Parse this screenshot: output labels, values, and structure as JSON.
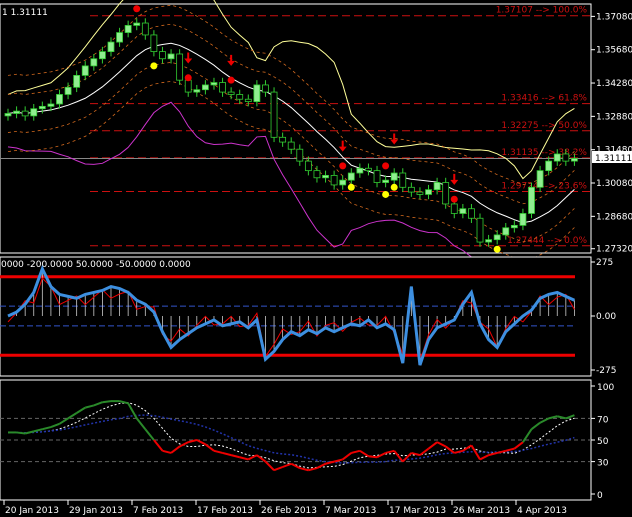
{
  "chart_data": [
    {
      "type": "candlestick",
      "title": "1 1.31111",
      "current_price": 1.31111,
      "current_price_label": "1.31111",
      "ylim": [
        1.2714,
        1.376
      ],
      "yticks": [
        "1.37080",
        "1.35680",
        "1.34280",
        "1.32880",
        "1.31480",
        "1.30080",
        "1.28680",
        "1.27320"
      ],
      "closes": [
        1.33,
        1.331,
        1.329,
        1.332,
        1.333,
        1.334,
        1.338,
        1.341,
        1.346,
        1.35,
        1.353,
        1.356,
        1.36,
        1.364,
        1.367,
        1.368,
        1.363,
        1.356,
        1.353,
        1.355,
        1.344,
        1.339,
        1.34,
        1.342,
        1.343,
        1.339,
        1.338,
        1.336,
        1.335,
        1.342,
        1.339,
        1.32,
        1.318,
        1.315,
        1.31,
        1.306,
        1.303,
        1.304,
        1.3,
        1.302,
        1.305,
        1.307,
        1.306,
        1.301,
        1.302,
        1.305,
        1.299,
        1.297,
        1.296,
        1.298,
        1.301,
        1.292,
        1.288,
        1.29,
        1.286,
        1.276,
        1.277,
        1.279,
        1.282,
        1.283,
        1.288,
        1.299,
        1.306,
        1.31,
        1.313,
        1.31,
        1.3111
      ],
      "down_arrows": [
        15,
        21,
        26,
        39,
        45,
        52
      ],
      "red_dots": [
        15,
        21,
        26,
        39,
        44,
        52
      ],
      "yellow_dots": [
        17,
        40,
        44,
        45,
        57
      ],
      "fib_levels": [
        {
          "price": 1.37107,
          "label": "1.37107 --> 100.0%"
        },
        {
          "price": 1.33416,
          "label": "1.33416 --> 61.8%"
        },
        {
          "price": 1.32275,
          "label": "1.32275 --> 50.0%"
        },
        {
          "price": 1.31135,
          "label": "1.31135 --> 38.2%"
        },
        {
          "price": 1.29724,
          "label": "1.29724 --> 23.6%"
        },
        {
          "price": 1.27444,
          "label": "1.27444 --> 0.0%"
        }
      ],
      "colors": {
        "bull": "#90ee90",
        "wick": "#32cd32",
        "fib": "#cc1010",
        "bands": "#ffff99",
        "mid": "#ffffff",
        "lower": "#cc33cc",
        "env": "#d2691e"
      }
    },
    {
      "type": "line",
      "name": "CCI",
      "levels_label": "0000 -200.0000 50.0000 -50.0000 0.0000",
      "ylim": [
        -275,
        275
      ],
      "yticks": [
        "275",
        "0.00",
        "-275"
      ],
      "levels": [
        200,
        -200,
        50,
        -50
      ],
      "values": [
        0,
        20,
        60,
        120,
        240,
        150,
        110,
        100,
        90,
        110,
        120,
        130,
        150,
        140,
        120,
        80,
        60,
        20,
        -80,
        -160,
        -120,
        -90,
        -60,
        -40,
        -20,
        -50,
        -40,
        -30,
        -60,
        -20,
        -220,
        -180,
        -120,
        -80,
        -100,
        -70,
        -90,
        -60,
        -80,
        -60,
        -40,
        -50,
        -20,
        -60,
        -40,
        -70,
        -240,
        150,
        -250,
        -120,
        -60,
        -40,
        -20,
        60,
        120,
        -40,
        -120,
        -160,
        -80,
        -40,
        0,
        30,
        90,
        110,
        120,
        100,
        80
      ]
    },
    {
      "type": "line",
      "name": "RSI",
      "ylim": [
        0,
        100
      ],
      "yticks": [
        "100",
        "70",
        "50",
        "30",
        "0"
      ],
      "levels": [
        70,
        50,
        30
      ],
      "values": [
        57,
        57,
        56,
        58,
        60,
        62,
        65,
        70,
        75,
        80,
        82,
        85,
        86,
        86,
        84,
        70,
        60,
        50,
        40,
        38,
        44,
        48,
        50,
        46,
        40,
        38,
        36,
        34,
        32,
        36,
        30,
        22,
        25,
        28,
        24,
        22,
        24,
        28,
        30,
        32,
        38,
        40,
        35,
        34,
        38,
        40,
        30,
        38,
        36,
        42,
        48,
        44,
        38,
        40,
        45,
        32,
        36,
        38,
        40,
        42,
        48,
        60,
        66,
        70,
        72,
        70,
        73
      ]
    }
  ],
  "x_axis": {
    "tick_labels": [
      "20 Jan 2013",
      "29 Jan 2013",
      "7 Feb 2013",
      "17 Feb 2013",
      "26 Feb 2013",
      "7 Mar 2013",
      "17 Mar 2013",
      "26 Mar 2013",
      "4 Apr 2013"
    ]
  }
}
